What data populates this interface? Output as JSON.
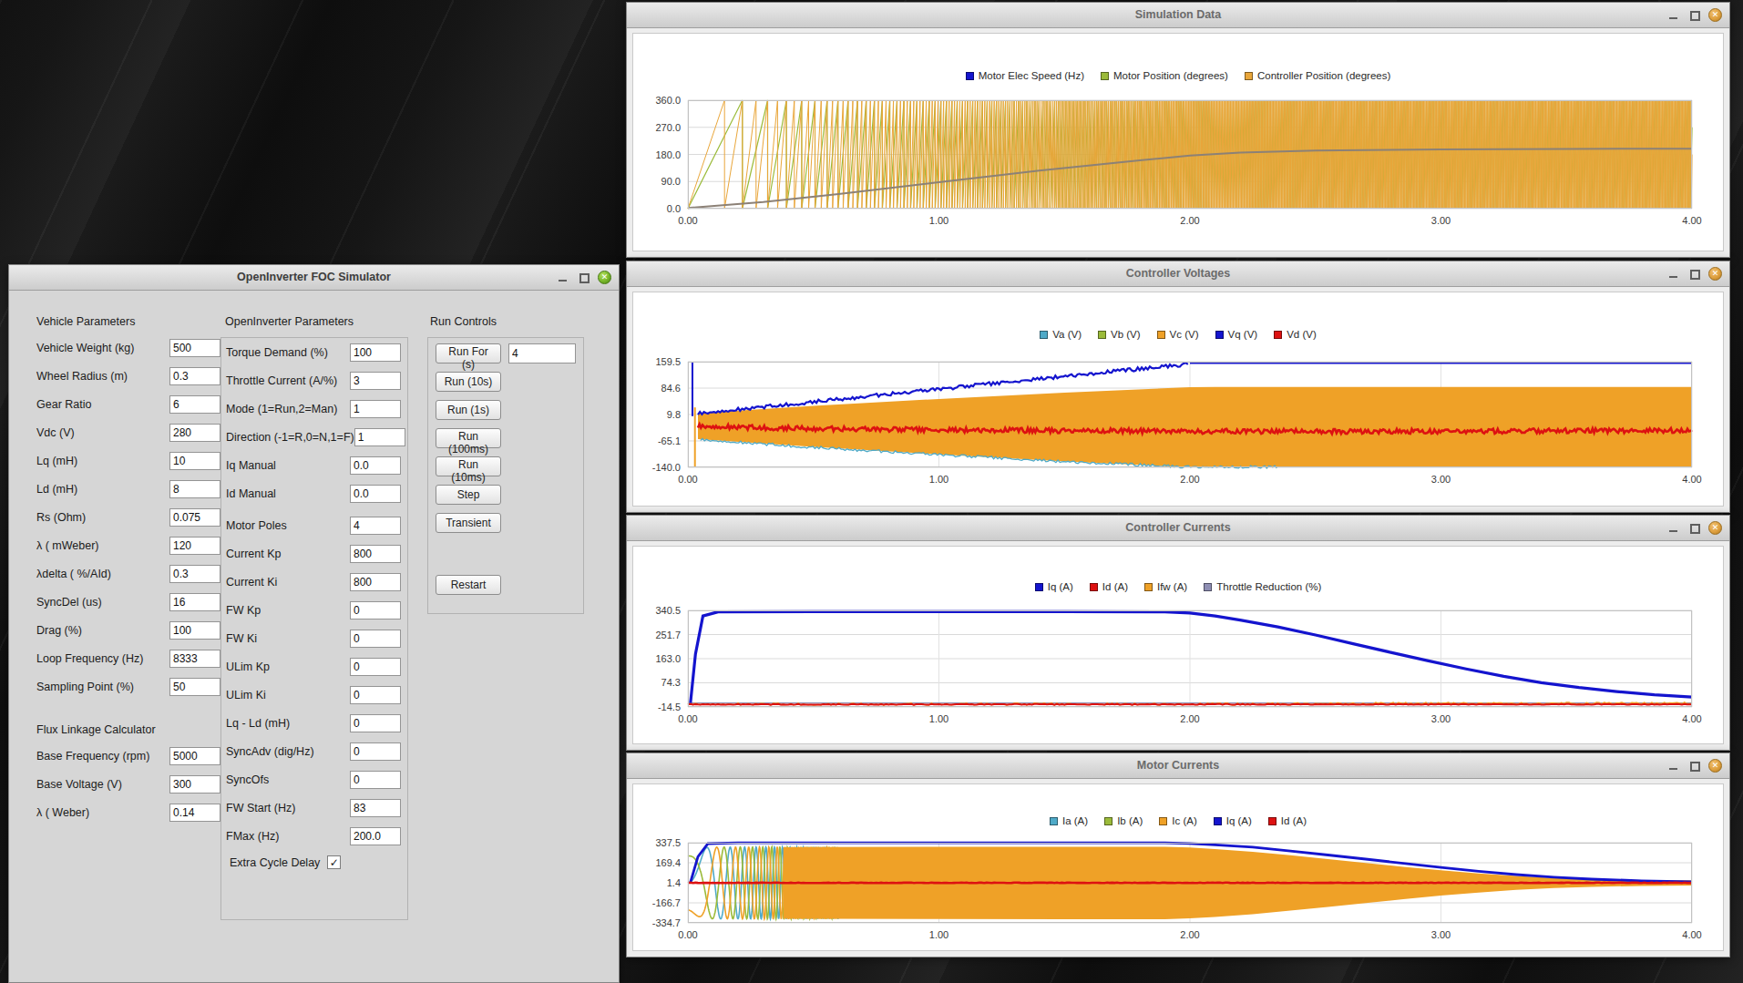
{
  "theme": {
    "close_button_active": "#77B62A",
    "close_button_inactive": "#DFA03F",
    "titlebar_text": "#3d3d3d"
  },
  "foc_window": {
    "title": "OpenInverter FOC Simulator",
    "groups": {
      "vehicle": {
        "heading": "Vehicle Parameters",
        "rows": [
          {
            "label": "Vehicle Weight (kg)",
            "value": "500"
          },
          {
            "label": "Wheel Radius (m)",
            "value": "0.3"
          },
          {
            "label": "Gear Ratio",
            "value": "6"
          },
          {
            "label": "Vdc (V)",
            "value": "280"
          },
          {
            "label": "Lq (mH)",
            "value": "10"
          },
          {
            "label": "Ld (mH)",
            "value": "8"
          },
          {
            "label": "Rs (Ohm)",
            "value": "0.075"
          },
          {
            "label": "λ ( mWeber)",
            "value": "120"
          },
          {
            "label": "λdelta ( %/AId)",
            "value": "0.3"
          },
          {
            "label": "SyncDel (us)",
            "value": "16"
          },
          {
            "label": "Drag (%)",
            "value": "100"
          },
          {
            "label": "Loop Frequency (Hz)",
            "value": "8333"
          },
          {
            "label": "Sampling Point (%)",
            "value": "50"
          }
        ]
      },
      "flux": {
        "heading": "Flux Linkage Calculator",
        "rows": [
          {
            "label": "Base Frequency (rpm)",
            "value": "5000"
          },
          {
            "label": "Base Voltage (V)",
            "value": "300"
          },
          {
            "label": "λ ( Weber)",
            "value": "0.14"
          }
        ]
      },
      "openinverter": {
        "heading": "OpenInverter Parameters",
        "rows": [
          {
            "label": "Torque Demand (%)",
            "value": "100"
          },
          {
            "label": "Throttle Current (A/%)",
            "value": "3"
          },
          {
            "label": "Mode (1=Run,2=Man)",
            "value": "1"
          },
          {
            "label": "Direction (-1=R,0=N,1=F)",
            "value": "1"
          },
          {
            "label": "Iq Manual",
            "value": "0.0"
          },
          {
            "label": "Id Manual",
            "value": "0.0"
          },
          {
            "label": "Motor Poles",
            "value": "4",
            "gap_before": true
          },
          {
            "label": "Current Kp",
            "value": "800"
          },
          {
            "label": "Current Ki",
            "value": "800"
          },
          {
            "label": "FW Kp",
            "value": "0"
          },
          {
            "label": "FW Ki",
            "value": "0"
          },
          {
            "label": "ULim Kp",
            "value": "0"
          },
          {
            "label": "ULim Ki",
            "value": "0"
          },
          {
            "label": "Lq - Ld (mH)",
            "value": "0"
          },
          {
            "label": "SyncAdv (dig/Hz)",
            "value": "0"
          },
          {
            "label": "SyncOfs",
            "value": "0"
          },
          {
            "label": "FW Start (Hz)",
            "value": "83"
          },
          {
            "label": "FMax (Hz)",
            "value": "200.0"
          }
        ],
        "checkbox": {
          "label": "Extra Cycle Delay",
          "checked": true,
          "check_glyph": "✓"
        }
      },
      "run": {
        "heading": "Run Controls",
        "run_for_button": "Run For (s)",
        "run_for_value": "4",
        "buttons": [
          "Run (10s)",
          "Run (1s)",
          "Run (100ms)",
          "Run (10ms)",
          "Step",
          "Transient"
        ],
        "restart_button": "Restart"
      }
    }
  },
  "chart_data": [
    {
      "id": "simulation",
      "type": "line",
      "title": "Simulation Data",
      "x_min": 0,
      "x_max": 4,
      "y_min": 0,
      "y_max": 360,
      "y_ticks": [
        "0.0",
        "90.0",
        "180.0",
        "270.0",
        "360.0"
      ],
      "x_ticks": [
        "0.00",
        "1.00",
        "2.00",
        "3.00",
        "4.00"
      ],
      "grid": true,
      "legend": [
        {
          "label": "Motor Elec Speed (Hz)",
          "color": "#1414CE"
        },
        {
          "label": "Motor Position (degrees)",
          "color": "#9BBB3A"
        },
        {
          "label": "Controller Position (degrees)",
          "color": "#E9A63A"
        }
      ],
      "speed_curve": [
        [
          0,
          2
        ],
        [
          0.3,
          22
        ],
        [
          0.6,
          48
        ],
        [
          1.0,
          88
        ],
        [
          1.4,
          126
        ],
        [
          1.8,
          160
        ],
        [
          2.0,
          176
        ],
        [
          2.2,
          186
        ],
        [
          2.5,
          193
        ],
        [
          3.0,
          197
        ],
        [
          3.5,
          198
        ],
        [
          4,
          199
        ]
      ],
      "series": [
        {
          "name": "Motor Position (degrees)",
          "kind": "sawtooth",
          "freq_scale": 0.5,
          "y1": 360,
          "color": "#9BBB3A",
          "width": 1.2
        },
        {
          "name": "Controller Position (degrees)",
          "kind": "sawtooth",
          "freq_scale": 1.0,
          "y1": 360,
          "color": "#E9A63A",
          "width": 1.0
        },
        {
          "name": "Motor Elec Speed (Hz)",
          "kind": "line",
          "points": "speed_curve",
          "color": "#8C8176",
          "width": 2
        }
      ]
    },
    {
      "id": "voltages",
      "type": "line",
      "title": "Controller Voltages",
      "x_min": 0,
      "x_max": 4,
      "y_min": -140,
      "y_max": 159.5,
      "y_ticks": [
        "159.5",
        "84.6",
        "9.8",
        "-65.1",
        "-140.0"
      ],
      "x_ticks": [
        "0.00",
        "1.00",
        "2.00",
        "3.00",
        "4.00"
      ],
      "grid": true,
      "legend": [
        {
          "label": "Va (V)",
          "color": "#4FAAC8"
        },
        {
          "label": "Vb (V)",
          "color": "#9BBB3A"
        },
        {
          "label": "Vc (V)",
          "color": "#EFA127"
        },
        {
          "label": "Vq (V)",
          "color": "#1414CE"
        },
        {
          "label": "Vd (V)",
          "color": "#DD1111"
        }
      ],
      "series": [
        {
          "name": "phase voltage envelope",
          "kind": "band",
          "color": "#EFA127",
          "top": [
            [
              0.04,
              14
            ],
            [
              0.5,
              34
            ],
            [
              1.0,
              54
            ],
            [
              1.5,
              72
            ],
            [
              2.0,
              87
            ],
            [
              2.1,
              88
            ],
            [
              4,
              88
            ]
          ],
          "bottom": [
            [
              0.04,
              -60
            ],
            [
              0.5,
              -82
            ],
            [
              1.0,
              -103
            ],
            [
              1.5,
              -123
            ],
            [
              2.0,
              -140
            ],
            [
              4,
              -140
            ]
          ]
        },
        {
          "name": "startup spike Vc",
          "kind": "vline",
          "x": 0.028,
          "y1": -140,
          "y2": 30,
          "color": "#EFA127",
          "width": 2
        },
        {
          "name": "startup spike Vq",
          "kind": "vline",
          "x": 0.018,
          "y1": 5,
          "y2": 158,
          "color": "#1414CE",
          "width": 2
        },
        {
          "name": "Va (V)",
          "kind": "noisy",
          "color": "#4FAAC8",
          "width": 1.3,
          "noise": 4,
          "step": 0.008,
          "points": [
            [
              0.05,
              -62
            ],
            [
              0.5,
              -83
            ],
            [
              1.0,
              -104
            ],
            [
              1.5,
              -124
            ],
            [
              2.0,
              -139
            ],
            [
              2.35,
              -139
            ]
          ]
        },
        {
          "name": "Vq (V)",
          "kind": "noisy",
          "color": "#1414CE",
          "width": 2.2,
          "noise": 5,
          "step": 0.008,
          "points": [
            [
              0.04,
              12
            ],
            [
              0.5,
              46
            ],
            [
              1.0,
              82
            ],
            [
              1.5,
              118
            ],
            [
              2.0,
              153
            ]
          ]
        },
        {
          "name": "Vq (V) saturated",
          "kind": "line",
          "color": "#1414CE",
          "width": 2,
          "points": [
            [
              2.0,
              156
            ],
            [
              4,
              156
            ]
          ]
        },
        {
          "name": "Vd (V)",
          "kind": "noisy",
          "color": "#DD1111",
          "width": 2.6,
          "noise": 7,
          "step": 0.006,
          "points": [
            [
              0.04,
              -24
            ],
            [
              0.5,
              -30
            ],
            [
              1.0,
              -34
            ],
            [
              1.5,
              -36
            ],
            [
              2.0,
              -38
            ],
            [
              3.0,
              -38
            ],
            [
              4,
              -35
            ]
          ]
        }
      ]
    },
    {
      "id": "controller_currents",
      "type": "line",
      "title": "Controller Currents",
      "x_min": 0,
      "x_max": 4,
      "y_min": -14.5,
      "y_max": 340.5,
      "y_ticks": [
        "340.5",
        "251.7",
        "163.0",
        "74.3",
        "-14.5"
      ],
      "x_ticks": [
        "0.00",
        "1.00",
        "2.00",
        "3.00",
        "4.00"
      ],
      "grid": true,
      "legend": [
        {
          "label": "Iq (A)",
          "color": "#1414CE"
        },
        {
          "label": "Id (A)",
          "color": "#DD1111"
        },
        {
          "label": "Ifw (A)",
          "color": "#EFA127"
        },
        {
          "label": "Throttle Reduction (%)",
          "color": "#8F8FB4"
        }
      ],
      "series": [
        {
          "name": "Throttle Reduction (%)",
          "kind": "line",
          "color": "#8F8FB4",
          "width": 1.2,
          "points": [
            [
              0,
              0
            ],
            [
              4,
              0
            ]
          ]
        },
        {
          "name": "Ifw (A)",
          "kind": "noisy",
          "color": "#EFA127",
          "width": 1.4,
          "noise": 4,
          "step": 0.01,
          "points": [
            [
              0,
              -4
            ],
            [
              2.2,
              -4
            ],
            [
              2.6,
              -2
            ],
            [
              4,
              -1
            ]
          ]
        },
        {
          "name": "Id (A)",
          "kind": "noisy",
          "color": "#DD1111",
          "width": 2,
          "noise": 1.5,
          "step": 0.01,
          "points": [
            [
              0,
              -5
            ],
            [
              4,
              -5
            ]
          ]
        },
        {
          "name": "Iq (A)",
          "kind": "line",
          "color": "#1414CE",
          "width": 3.2,
          "points": [
            [
              0.01,
              0
            ],
            [
              0.03,
              180
            ],
            [
              0.06,
              320
            ],
            [
              0.12,
              335
            ],
            [
              0.5,
              336
            ],
            [
              1.0,
              336
            ],
            [
              1.5,
              336
            ],
            [
              1.9,
              335
            ],
            [
              2.0,
              331
            ],
            [
              2.1,
              320
            ],
            [
              2.2,
              305
            ],
            [
              2.35,
              280
            ],
            [
              2.5,
              250
            ],
            [
              2.65,
              218
            ],
            [
              2.8,
              186
            ],
            [
              2.95,
              155
            ],
            [
              3.1,
              125
            ],
            [
              3.25,
              98
            ],
            [
              3.4,
              75
            ],
            [
              3.55,
              57
            ],
            [
              3.7,
              42
            ],
            [
              3.85,
              30
            ],
            [
              4,
              22
            ]
          ]
        }
      ]
    },
    {
      "id": "motor_currents",
      "type": "line",
      "title": "Motor Currents",
      "x_min": 0,
      "x_max": 4,
      "y_min": -334.7,
      "y_max": 337.5,
      "y_ticks": [
        "337.5",
        "169.4",
        "1.4",
        "-166.7",
        "-334.7"
      ],
      "x_ticks": [
        "0.00",
        "1.00",
        "2.00",
        "3.00",
        "4.00"
      ],
      "grid": true,
      "legend": [
        {
          "label": "Ia (A)",
          "color": "#4FAAC8"
        },
        {
          "label": "Ib (A)",
          "color": "#9BBB3A"
        },
        {
          "label": "Ic (A)",
          "color": "#EFA127"
        },
        {
          "label": "Iq (A)",
          "color": "#1414CE"
        },
        {
          "label": "Id (A)",
          "color": "#DD1111"
        }
      ],
      "series": [
        {
          "name": "startup phase currents",
          "kind": "chirp3",
          "t0": 0,
          "t1": 0.6,
          "rate": 88,
          "step": 0.0015,
          "amp": [
            [
              0,
              260
            ],
            [
              0.08,
              300
            ],
            [
              0.6,
              303
            ]
          ],
          "colors": [
            "#4FAAC8",
            "#9BBB3A",
            "#EFA127"
          ],
          "width": 1.6
        },
        {
          "name": "phase current envelope",
          "kind": "band",
          "color": "#EFA127",
          "top": [
            [
              0.38,
              300
            ],
            [
              0.5,
              301
            ],
            [
              1.0,
              302
            ],
            [
              1.5,
              303
            ],
            [
              1.9,
              303
            ],
            [
              2.0,
              297
            ],
            [
              2.1,
              285
            ],
            [
              2.25,
              262
            ],
            [
              2.4,
              232
            ],
            [
              2.55,
              200
            ],
            [
              2.7,
              168
            ],
            [
              2.85,
              136
            ],
            [
              3.0,
              106
            ],
            [
              3.15,
              80
            ],
            [
              3.3,
              58
            ],
            [
              3.45,
              42
            ],
            [
              3.6,
              32
            ],
            [
              3.8,
              25
            ],
            [
              4,
              22
            ]
          ],
          "bottom": [
            [
              0.38,
              -300
            ],
            [
              0.5,
              -301
            ],
            [
              1.0,
              -302
            ],
            [
              1.5,
              -303
            ],
            [
              1.9,
              -303
            ],
            [
              2.0,
              -297
            ],
            [
              2.1,
              -285
            ],
            [
              2.25,
              -262
            ],
            [
              2.4,
              -232
            ],
            [
              2.55,
              -200
            ],
            [
              2.7,
              -168
            ],
            [
              2.85,
              -136
            ],
            [
              3.0,
              -106
            ],
            [
              3.15,
              -80
            ],
            [
              3.3,
              -58
            ],
            [
              3.45,
              -42
            ],
            [
              3.6,
              -32
            ],
            [
              3.8,
              -25
            ],
            [
              4,
              -22
            ]
          ]
        },
        {
          "name": "Iq (A)",
          "kind": "line",
          "color": "#1414CE",
          "width": 2.8,
          "points": [
            [
              0.01,
              5
            ],
            [
              0.04,
              220
            ],
            [
              0.08,
              330
            ],
            [
              0.2,
              337
            ],
            [
              1.0,
              337
            ],
            [
              1.9,
              336
            ],
            [
              2.0,
              331
            ],
            [
              2.1,
              320
            ],
            [
              2.25,
              300
            ],
            [
              2.4,
              268
            ],
            [
              2.55,
              234
            ],
            [
              2.7,
              200
            ],
            [
              2.85,
              165
            ],
            [
              3.0,
              130
            ],
            [
              3.15,
              98
            ],
            [
              3.3,
              70
            ],
            [
              3.45,
              48
            ],
            [
              3.6,
              32
            ],
            [
              3.8,
              18
            ],
            [
              4,
              10
            ]
          ]
        },
        {
          "name": "Id (A)",
          "kind": "noisy",
          "color": "#DD1111",
          "width": 2.6,
          "noise": 2,
          "step": 0.01,
          "points": [
            [
              0,
              1
            ],
            [
              4,
              1
            ]
          ]
        }
      ]
    }
  ]
}
